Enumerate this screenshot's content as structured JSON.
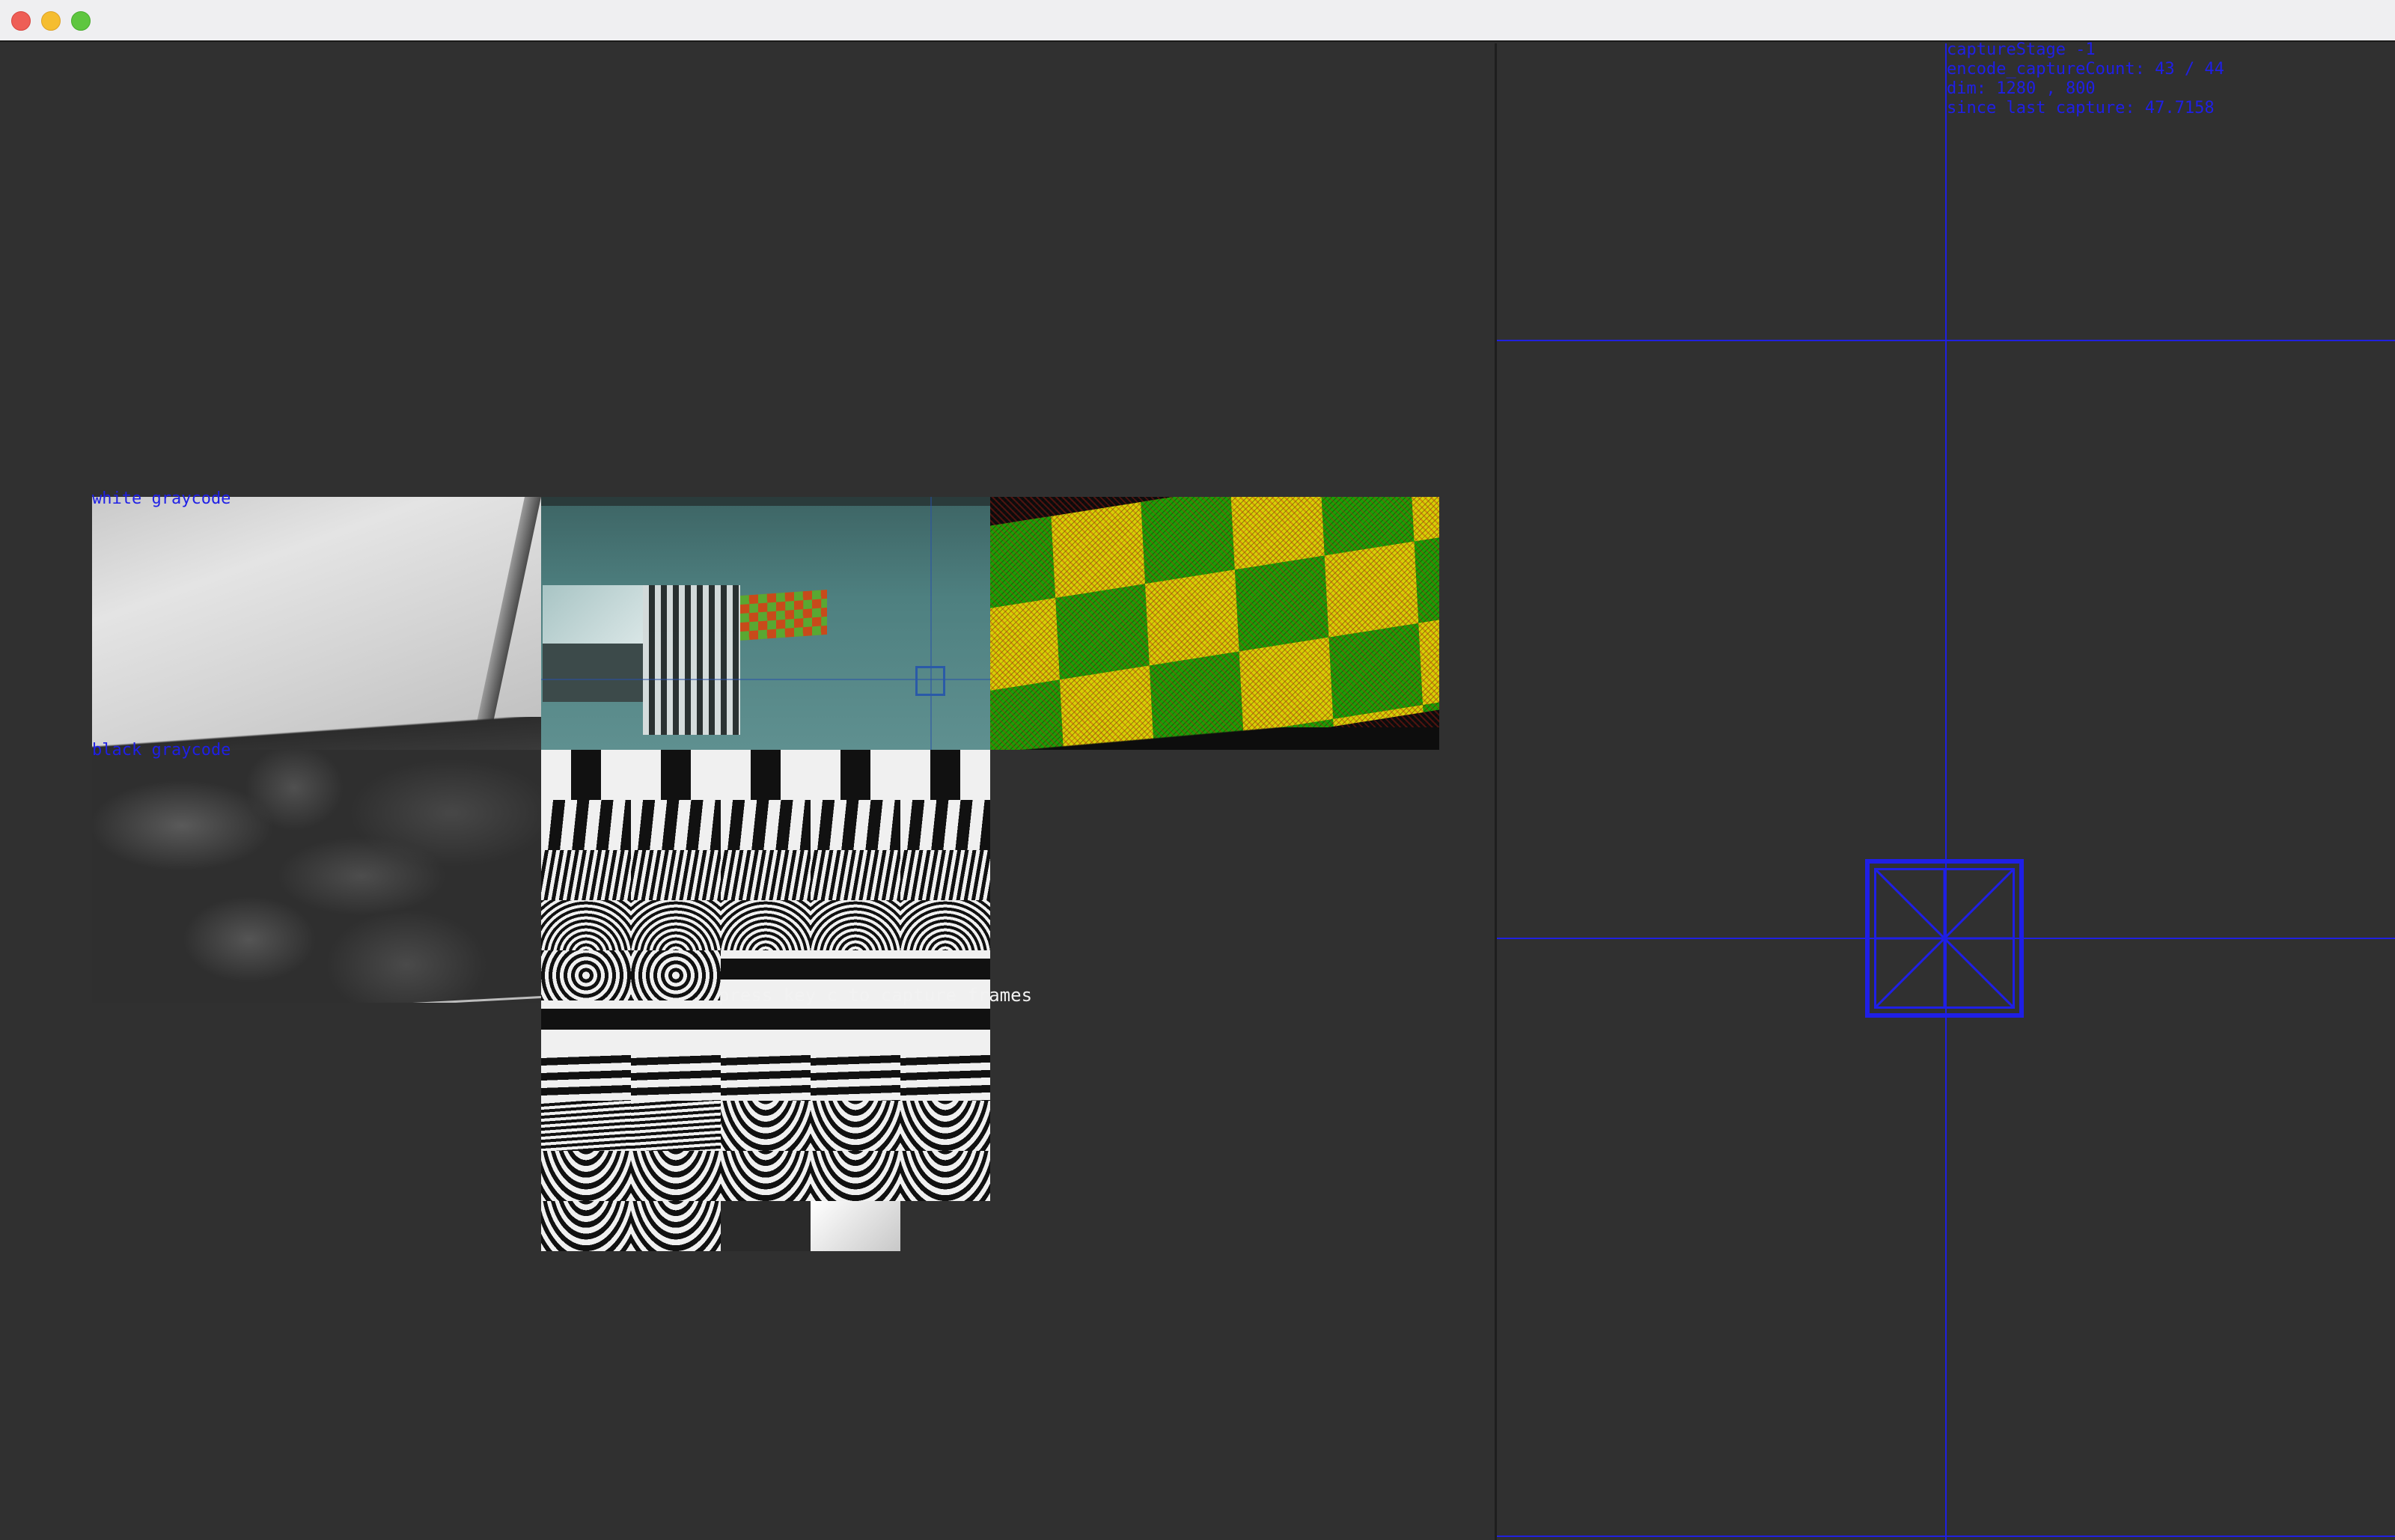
{
  "window": {
    "controls": [
      "close",
      "minimize",
      "maximize"
    ]
  },
  "left_view": {
    "tiles": {
      "white_label": "white graycode",
      "black_label": "black graycode"
    },
    "instruction": "press key c to capture frames"
  },
  "right_view": {
    "status_lines": [
      "captureStage -1",
      "encode_captureCount: 43 / 44",
      "dim: 1280 , 800",
      "since last capture: 47.7158"
    ]
  },
  "colors": {
    "overlay_blue": "#1f1fe6",
    "background": "#303030",
    "titlebar": "#efeff1"
  },
  "pattern_grid": {
    "cells": [
      "vwide",
      "vwide",
      "vwide",
      "vwide",
      "vwide",
      "vmed",
      "vmed",
      "vmed",
      "vmed",
      "vmed",
      "vfine",
      "vfine",
      "vfine",
      "vfine",
      "vfine",
      "radial",
      "radial",
      "radial",
      "radial",
      "radial",
      "radial2",
      "radial2",
      "hwide",
      "hwide",
      "hwide",
      "hwide",
      "hwide",
      "hwide",
      "hwide",
      "hwide",
      "hmed",
      "hmed",
      "hmed",
      "hmed",
      "hmed",
      "hfine",
      "hfine",
      "arc",
      "arc",
      "arc",
      "arc",
      "arc",
      "arc",
      "arc",
      "arc",
      "arc",
      "arc",
      "dark",
      "light",
      "empty"
    ]
  }
}
